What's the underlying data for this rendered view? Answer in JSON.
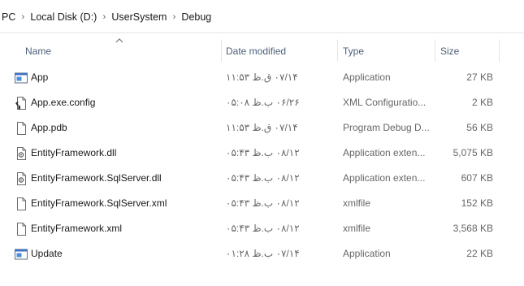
{
  "breadcrumb": [
    "PC",
    "Local Disk (D:)",
    "UserSystem",
    "Debug"
  ],
  "columns": {
    "name": "Name",
    "date": "Date modified",
    "type": "Type",
    "size": "Size"
  },
  "files": [
    {
      "name": "App",
      "date": "۰۷/۱۴ ق.ظ ۱۱:۵۳",
      "type": "Application",
      "size": "27 KB",
      "icon": "application-icon"
    },
    {
      "name": "App.exe.config",
      "date": "۰۶/۲۶ ب.ظ ۰۵:۰۸",
      "type": "XML Configuratio...",
      "size": "2 KB",
      "icon": "config-file-icon"
    },
    {
      "name": "App.pdb",
      "date": "۰۷/۱۴ ق.ظ ۱۱:۵۳",
      "type": "Program Debug D...",
      "size": "56 KB",
      "icon": "blank-file-icon"
    },
    {
      "name": "EntityFramework.dll",
      "date": "۰۸/۱۲ ب.ظ ۰۵:۴۳",
      "type": "Application exten...",
      "size": "5,075 KB",
      "icon": "dll-file-icon"
    },
    {
      "name": "EntityFramework.SqlServer.dll",
      "date": "۰۸/۱۲ ب.ظ ۰۵:۴۳",
      "type": "Application exten...",
      "size": "607 KB",
      "icon": "dll-file-icon"
    },
    {
      "name": "EntityFramework.SqlServer.xml",
      "date": "۰۸/۱۲ ب.ظ ۰۵:۴۳",
      "type": "xmlfile",
      "size": "152 KB",
      "icon": "blank-file-icon"
    },
    {
      "name": "EntityFramework.xml",
      "date": "۰۸/۱۲ ب.ظ ۰۵:۴۳",
      "type": "xmlfile",
      "size": "3,568 KB",
      "icon": "blank-file-icon"
    },
    {
      "name": "Update",
      "date": "۰۷/۱۴ ب.ظ ۰۱:۲۸",
      "type": "Application",
      "size": "22 KB",
      "icon": "application-icon"
    }
  ]
}
